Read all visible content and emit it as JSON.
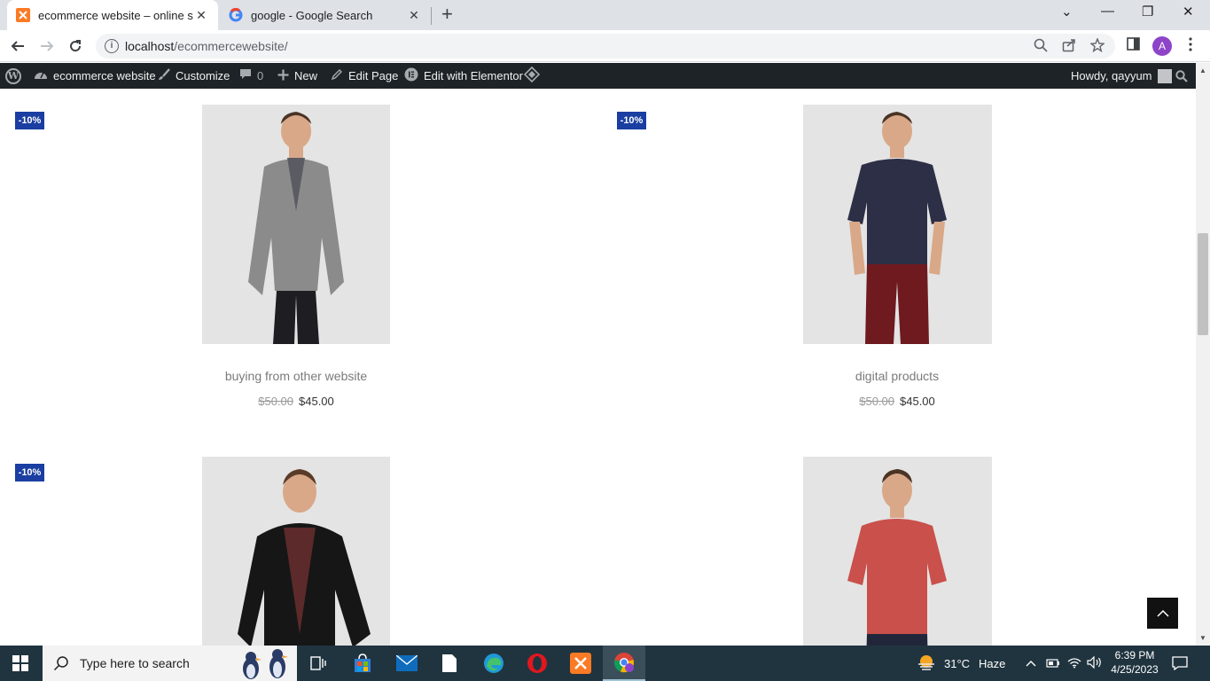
{
  "browser": {
    "tabs": [
      {
        "title": "ecommerce website – online store",
        "active": true
      },
      {
        "title": "google - Google Search",
        "active": false
      }
    ],
    "new_tab": "+",
    "close_glyph": "✕",
    "window_controls": {
      "chevron": "⌄",
      "minimize": "—",
      "restore": "❐",
      "close": "✕"
    },
    "url_host": "localhost",
    "url_path": "/ecommercewebsite/",
    "profile_initial": "A"
  },
  "admin_bar": {
    "site_name": "ecommerce website",
    "customize": "Customize",
    "comments_count": "0",
    "new": "New",
    "edit_page": "Edit Page",
    "edit_elementor": "Edit with Elementor",
    "howdy": "Howdy, qayyum"
  },
  "products": [
    {
      "badge": "-10%",
      "name": "buying from other website",
      "old_price": "$50.00",
      "price": "$45.00"
    },
    {
      "badge": "-10%",
      "name": "digital products",
      "old_price": "$50.00",
      "price": "$45.00"
    },
    {
      "badge": "-10%",
      "name": "",
      "old_price": "",
      "price": ""
    },
    {
      "badge": "",
      "name": "",
      "old_price": "",
      "price": ""
    }
  ],
  "taskbar": {
    "search_placeholder": "Type here to search",
    "weather_temp": "31°C",
    "weather_desc": "Haze",
    "time": "6:39 PM",
    "date": "4/25/2023"
  },
  "colors": {
    "sale_badge": "#1a3ea1",
    "admin_bar": "#1d2327",
    "taskbar": "#20343f"
  }
}
